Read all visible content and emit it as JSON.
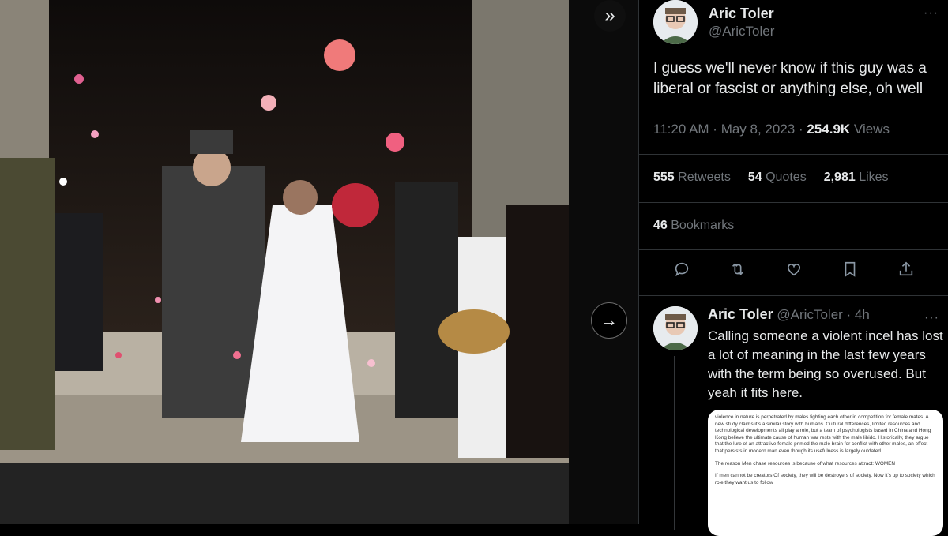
{
  "nav": {
    "expand_icon": "»",
    "next_icon": "→"
  },
  "tweet": {
    "author_name": "Aric Toler",
    "author_handle": "@AricToler",
    "text": "I guess we'll never know if this guy was a liberal or fascist or anything else, oh well",
    "time": "11:20 AM",
    "date": "May 8, 2023",
    "views_count": "254.9K",
    "views_label": "Views",
    "retweets_count": "555",
    "retweets_label": "Retweets",
    "quotes_count": "54",
    "quotes_label": "Quotes",
    "likes_count": "2,981",
    "likes_label": "Likes",
    "bookmarks_count": "46",
    "bookmarks_label": "Bookmarks",
    "more_icon": "···"
  },
  "reply": {
    "author_name": "Aric Toler",
    "author_handle": "@AricToler",
    "age": "· 4h",
    "text": "Calling someone a violent incel has lost a lot of meaning in the last few years with the term being so overused. But yeah it fits here.",
    "more_icon": "···",
    "doc_paragraph_1": "violence in nature is perpetrated by males fighting each other in competition for female mates. A new study claims it's a similar story with humans. Cultural differences, limited resources and technological developments all play a role, but a team of psychologists based in China and Hong Kong believe the ultimate cause of human war rests with the male libido. Historically, they argue that the lure of an attractive female primed the male brain for conflict with other males, an effect that persists in modern man even though its usefulness is largely outdated",
    "doc_paragraph_2": "The reason Men chase resources is because of what resources attract: WOMEN",
    "doc_paragraph_3": "If men cannot be creators Of society, they will be destroyers of society. Now it's up to society which role they want us to follow"
  },
  "colors": {
    "background": "#000000",
    "text": "#e7e9ea",
    "muted": "#71767b",
    "border": "#2f3336"
  }
}
